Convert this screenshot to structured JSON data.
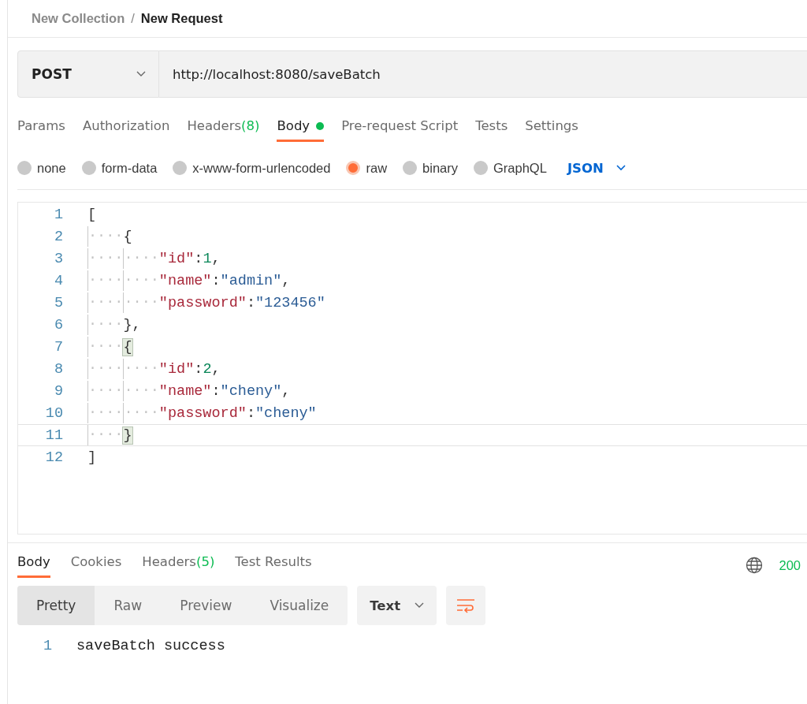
{
  "breadcrumb": {
    "parent": "New Collection",
    "separator": "/",
    "current": "New Request"
  },
  "request": {
    "method": "POST",
    "url": "http://localhost:8080/saveBatch"
  },
  "request_tabs": [
    {
      "label": "Params",
      "dot": false,
      "selected": false
    },
    {
      "label": "Authorization",
      "dot": false,
      "selected": false
    },
    {
      "label": "Headers",
      "badge": "(8)",
      "dot": false,
      "selected": false
    },
    {
      "label": "Body",
      "dot": true,
      "selected": true
    },
    {
      "label": "Pre-request Script",
      "dot": false,
      "selected": false
    },
    {
      "label": "Tests",
      "dot": false,
      "selected": false
    },
    {
      "label": "Settings",
      "dot": false,
      "selected": false
    }
  ],
  "body_types": [
    {
      "label": "none",
      "selected": false
    },
    {
      "label": "form-data",
      "selected": false
    },
    {
      "label": "x-www-form-urlencoded",
      "selected": false
    },
    {
      "label": "raw",
      "selected": true
    },
    {
      "label": "binary",
      "selected": false
    },
    {
      "label": "GraphQL",
      "selected": false
    }
  ],
  "body_format": "JSON",
  "editor": {
    "lines": [
      {
        "number": "1",
        "current": false,
        "tokens": [
          {
            "kind": "punct",
            "text": "["
          }
        ]
      },
      {
        "number": "2",
        "current": false,
        "tokens": [
          {
            "kind": "ws",
            "text": "····"
          },
          {
            "kind": "punct",
            "text": "{"
          }
        ]
      },
      {
        "number": "3",
        "current": false,
        "tokens": [
          {
            "kind": "ws",
            "text": "········"
          },
          {
            "kind": "key",
            "text": "\"id\""
          },
          {
            "kind": "punct",
            "text": ":"
          },
          {
            "kind": "number",
            "text": "1"
          },
          {
            "kind": "punct",
            "text": ","
          }
        ]
      },
      {
        "number": "4",
        "current": false,
        "tokens": [
          {
            "kind": "ws",
            "text": "········"
          },
          {
            "kind": "key",
            "text": "\"name\""
          },
          {
            "kind": "punct",
            "text": ":"
          },
          {
            "kind": "string",
            "text": "\"admin\""
          },
          {
            "kind": "punct",
            "text": ","
          }
        ]
      },
      {
        "number": "5",
        "current": false,
        "tokens": [
          {
            "kind": "ws",
            "text": "········"
          },
          {
            "kind": "key",
            "text": "\"password\""
          },
          {
            "kind": "punct",
            "text": ":"
          },
          {
            "kind": "string",
            "text": "\"123456\""
          }
        ]
      },
      {
        "number": "6",
        "current": false,
        "tokens": [
          {
            "kind": "ws",
            "text": "····"
          },
          {
            "kind": "punct",
            "text": "},"
          }
        ]
      },
      {
        "number": "7",
        "current": false,
        "tokens": [
          {
            "kind": "ws",
            "text": "····"
          },
          {
            "kind": "match",
            "text": "{"
          }
        ]
      },
      {
        "number": "8",
        "current": false,
        "tokens": [
          {
            "kind": "ws",
            "text": "········"
          },
          {
            "kind": "key",
            "text": "\"id\""
          },
          {
            "kind": "punct",
            "text": ":"
          },
          {
            "kind": "number",
            "text": "2"
          },
          {
            "kind": "punct",
            "text": ","
          }
        ]
      },
      {
        "number": "9",
        "current": false,
        "tokens": [
          {
            "kind": "ws",
            "text": "········"
          },
          {
            "kind": "key",
            "text": "\"name\""
          },
          {
            "kind": "punct",
            "text": ":"
          },
          {
            "kind": "string",
            "text": "\"cheny\""
          },
          {
            "kind": "punct",
            "text": ","
          }
        ]
      },
      {
        "number": "10",
        "current": false,
        "tokens": [
          {
            "kind": "ws",
            "text": "········"
          },
          {
            "kind": "key",
            "text": "\"password\""
          },
          {
            "kind": "punct",
            "text": ":"
          },
          {
            "kind": "string",
            "text": "\"cheny\""
          }
        ]
      },
      {
        "number": "11",
        "current": true,
        "tokens": [
          {
            "kind": "ws",
            "text": "····"
          },
          {
            "kind": "match",
            "text": "}"
          }
        ]
      },
      {
        "number": "12",
        "current": false,
        "tokens": [
          {
            "kind": "punct",
            "text": "]"
          }
        ]
      }
    ]
  },
  "response": {
    "tabs": [
      {
        "label": "Body",
        "selected": true
      },
      {
        "label": "Cookies",
        "selected": false
      },
      {
        "label": "Headers",
        "badge": "(5)",
        "selected": false
      },
      {
        "label": "Test Results",
        "selected": false
      }
    ],
    "status": "200",
    "views": [
      {
        "label": "Pretty",
        "selected": true
      },
      {
        "label": "Raw",
        "selected": false
      },
      {
        "label": "Preview",
        "selected": false
      },
      {
        "label": "Visualize",
        "selected": false
      }
    ],
    "format": "Text",
    "lines": [
      {
        "number": "1",
        "text": "saveBatch success"
      }
    ]
  }
}
